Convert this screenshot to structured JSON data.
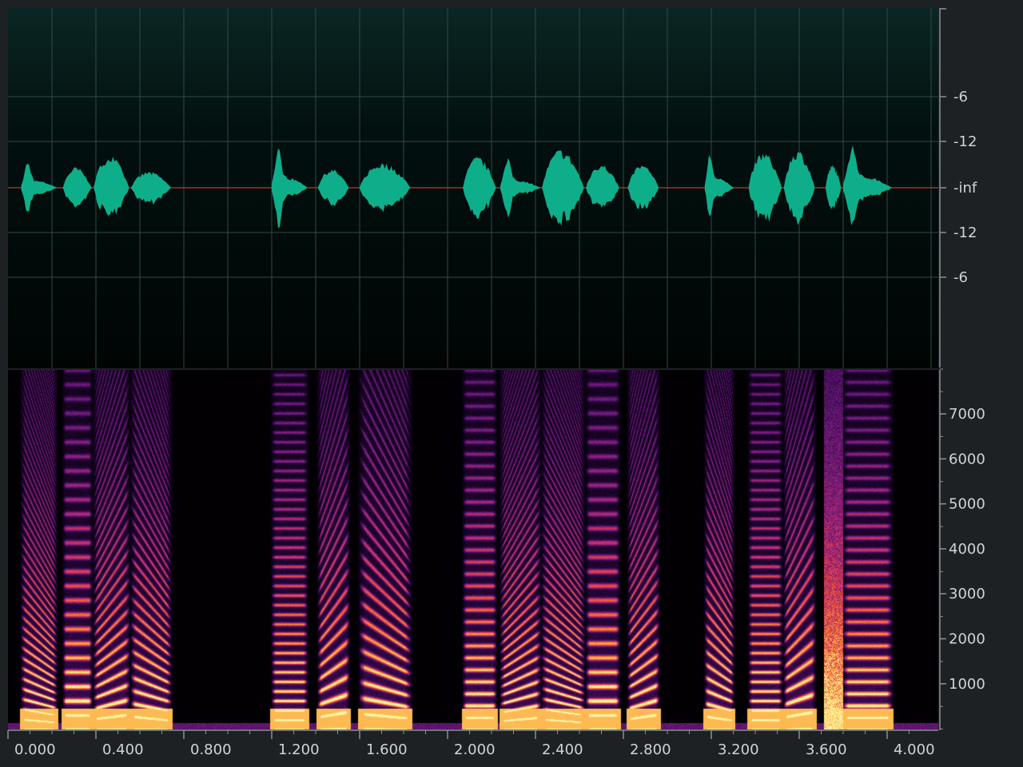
{
  "waveform": {
    "amplitude_scale": {
      "labels_top": [
        "-6",
        "-12"
      ],
      "label_center": "-inf",
      "labels_bottom": [
        "-12",
        "-6"
      ]
    },
    "colors": {
      "wave": "#0fae8a",
      "grid": "#2d4a48",
      "centerline": "#c0392b"
    }
  },
  "spectrogram": {
    "frequency_scale": {
      "labels": [
        "7000",
        "6000",
        "5000",
        "4000",
        "3000",
        "2000",
        "1000"
      ],
      "max_hz": 8000
    },
    "colormap": [
      "#000000",
      "#2a0640",
      "#6b1a7a",
      "#c42a6a",
      "#f25a2a",
      "#fdb44a",
      "#fff2a0"
    ]
  },
  "time_ruler": {
    "labels": [
      "0.000",
      "0.400",
      "0.800",
      "1.200",
      "1.600",
      "2.000",
      "2.400",
      "2.800",
      "3.200",
      "3.600",
      "4.000"
    ],
    "duration_s": 4.2
  },
  "segments": [
    {
      "t0": 0.06,
      "t1": 0.22
    },
    {
      "t0": 0.25,
      "t1": 0.38
    },
    {
      "t0": 0.39,
      "t1": 0.55
    },
    {
      "t0": 0.56,
      "t1": 0.74
    },
    {
      "t0": 1.2,
      "t1": 1.36
    },
    {
      "t0": 1.41,
      "t1": 1.55
    },
    {
      "t0": 1.6,
      "t1": 1.83
    },
    {
      "t0": 2.07,
      "t1": 2.22
    },
    {
      "t0": 2.24,
      "t1": 2.42
    },
    {
      "t0": 2.43,
      "t1": 2.62
    },
    {
      "t0": 2.63,
      "t1": 2.78
    },
    {
      "t0": 2.82,
      "t1": 2.96
    },
    {
      "t0": 3.17,
      "t1": 3.3
    },
    {
      "t0": 3.37,
      "t1": 3.52
    },
    {
      "t0": 3.53,
      "t1": 3.67
    },
    {
      "t0": 3.72,
      "t1": 3.79
    },
    {
      "t0": 3.8,
      "t1": 4.02
    }
  ]
}
